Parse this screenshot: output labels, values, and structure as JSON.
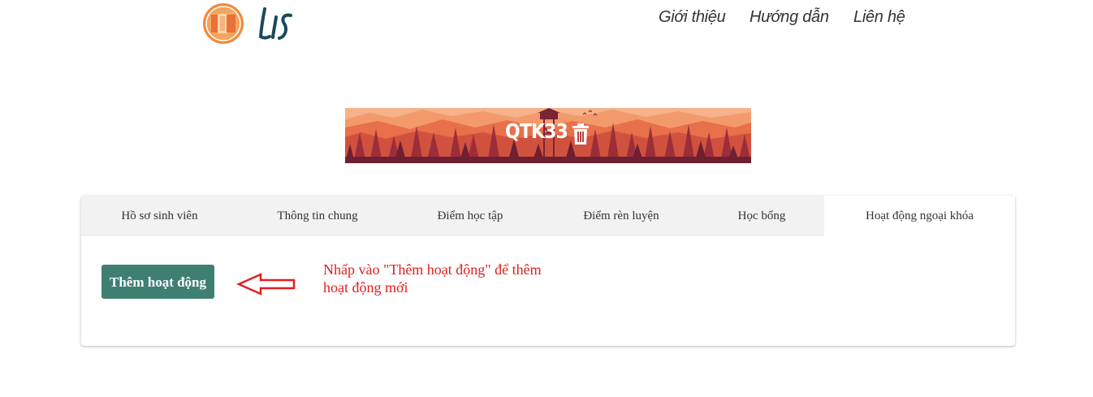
{
  "header": {
    "logo_text": "LIS",
    "nav": [
      "Giới thiệu",
      "Hướng dẫn",
      "Liên hệ"
    ]
  },
  "banner": {
    "title": "QTK33",
    "delete_icon": "trash-icon"
  },
  "tabs": [
    {
      "label": "Hồ sơ sinh viên",
      "active": false
    },
    {
      "label": "Thông tin chung",
      "active": false
    },
    {
      "label": "Điểm học tập",
      "active": false
    },
    {
      "label": "Điểm rèn luyện",
      "active": false
    },
    {
      "label": "Học bổng",
      "active": false
    },
    {
      "label": "Hoạt động ngoại khóa",
      "active": true
    }
  ],
  "content": {
    "add_button_label": "Thêm hoạt động",
    "hint_line1": "Nhấp vào \"Thêm hoạt động\" để thêm",
    "hint_line2": "hoạt động mới"
  },
  "colors": {
    "button": "#3f7f72",
    "hint": "#e02020",
    "tab_bar": "#f2f2f2"
  }
}
